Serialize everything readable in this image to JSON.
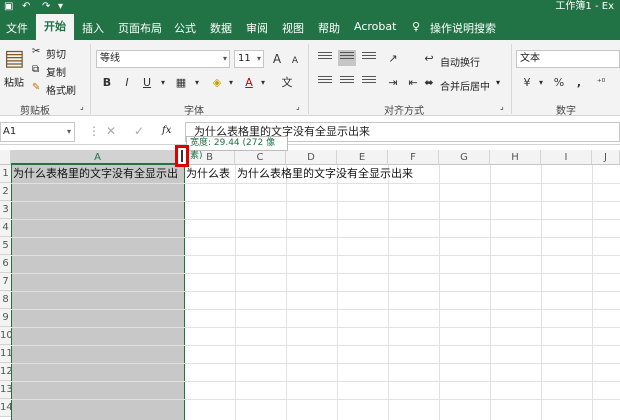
{
  "title": "工作簿1 - Ex",
  "tabs": [
    "文件",
    "开始",
    "插入",
    "页面布局",
    "公式",
    "数据",
    "审阅",
    "视图",
    "帮助",
    "Acrobat"
  ],
  "active_tab": "开始",
  "tell_me": "操作说明搜索",
  "clipboard": {
    "paste": "粘贴",
    "cut": "剪切",
    "copy": "复制",
    "format_painter": "格式刷",
    "group": "剪贴板"
  },
  "font": {
    "name": "等线",
    "size": "11",
    "bold": "B",
    "italic": "I",
    "underline": "U",
    "grow": "A",
    "shrink": "A",
    "font_color": "A",
    "group": "字体"
  },
  "alignment": {
    "wrap_text": "自动换行",
    "merge_center": "合并后居中",
    "group": "对齐方式"
  },
  "number": {
    "format": "文本",
    "percent": "%",
    "comma": ",",
    "group": "数字"
  },
  "formula_bar": {
    "name_box": "A1",
    "fx": "fx",
    "value": "为什么表格里的文字没有全显示出来"
  },
  "tooltip": "宽度: 29.44 (272 像素)",
  "columns": [
    "A",
    "B",
    "C",
    "D",
    "E",
    "F",
    "G",
    "H",
    "I",
    "J"
  ],
  "rows": [
    "1",
    "2",
    "3",
    "4",
    "5",
    "6",
    "7",
    "8",
    "9",
    "10",
    "11",
    "12",
    "13",
    "14"
  ],
  "cells": {
    "A1": "为什么表格里的文字没有全显示出",
    "B1": "为什么表",
    "C1": "为什么表格里的文字没有全显示出来"
  }
}
